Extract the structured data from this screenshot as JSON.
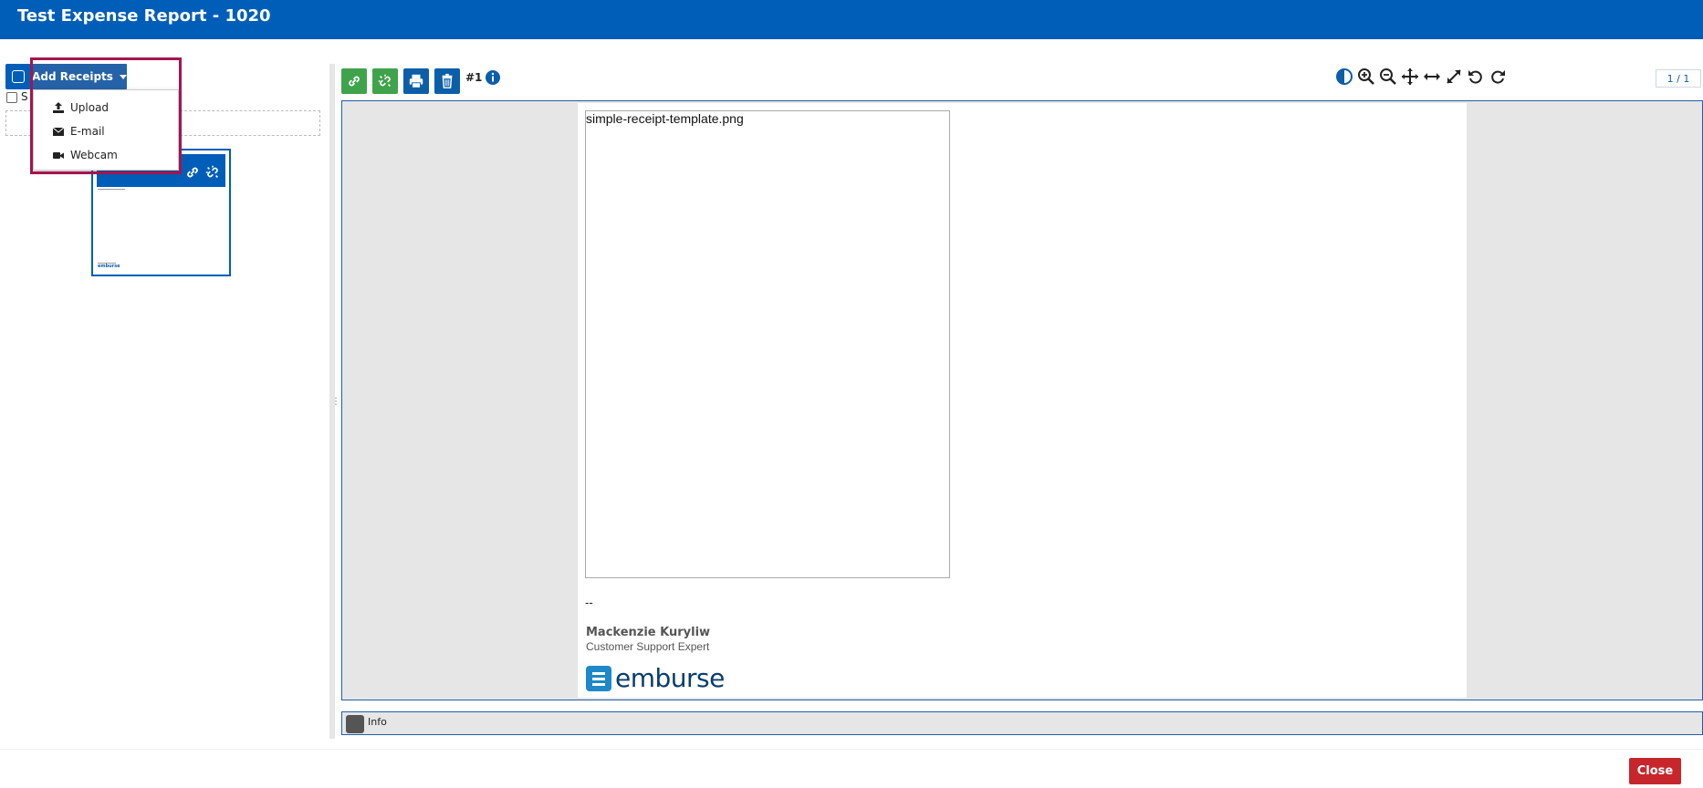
{
  "window": {
    "title": "Test Expense Report - 1020"
  },
  "left_panel": {
    "add_receipts_label": "Add Receipts",
    "select_label": "S",
    "dropdown_items": [
      {
        "label": "Upload",
        "icon": "upload-icon"
      },
      {
        "label": "E-mail",
        "icon": "envelope-icon"
      },
      {
        "label": "Webcam",
        "icon": "video-camera-icon"
      }
    ]
  },
  "toolbar": {
    "attach_icon": "link-icon",
    "detach_icon": "unlink-icon",
    "print_icon": "print-icon",
    "delete_icon": "trash-icon",
    "doc_number": "#1",
    "info_icon": "info-icon",
    "view_tools": [
      "contrast-icon",
      "zoom-in-icon",
      "zoom-out-icon",
      "move-icon",
      "fit-width-icon",
      "fullscreen-icon",
      "rotate-left-icon",
      "rotate-right-icon"
    ],
    "page_indicator": "1 / 1"
  },
  "viewer": {
    "attachment_name": "simple-receipt-template.png",
    "signature_dash": "--",
    "signature_name": "Mackenzie Kuryliw",
    "signature_title": "Customer Support Expert",
    "logo_text": "emburse"
  },
  "info_bar": {
    "label": "Info"
  },
  "footer": {
    "close_label": "Close"
  },
  "colors": {
    "brand_blue": "#005eb8",
    "green": "#3ea34a",
    "close_red": "#c6262c",
    "highlight": "#a3154f"
  }
}
